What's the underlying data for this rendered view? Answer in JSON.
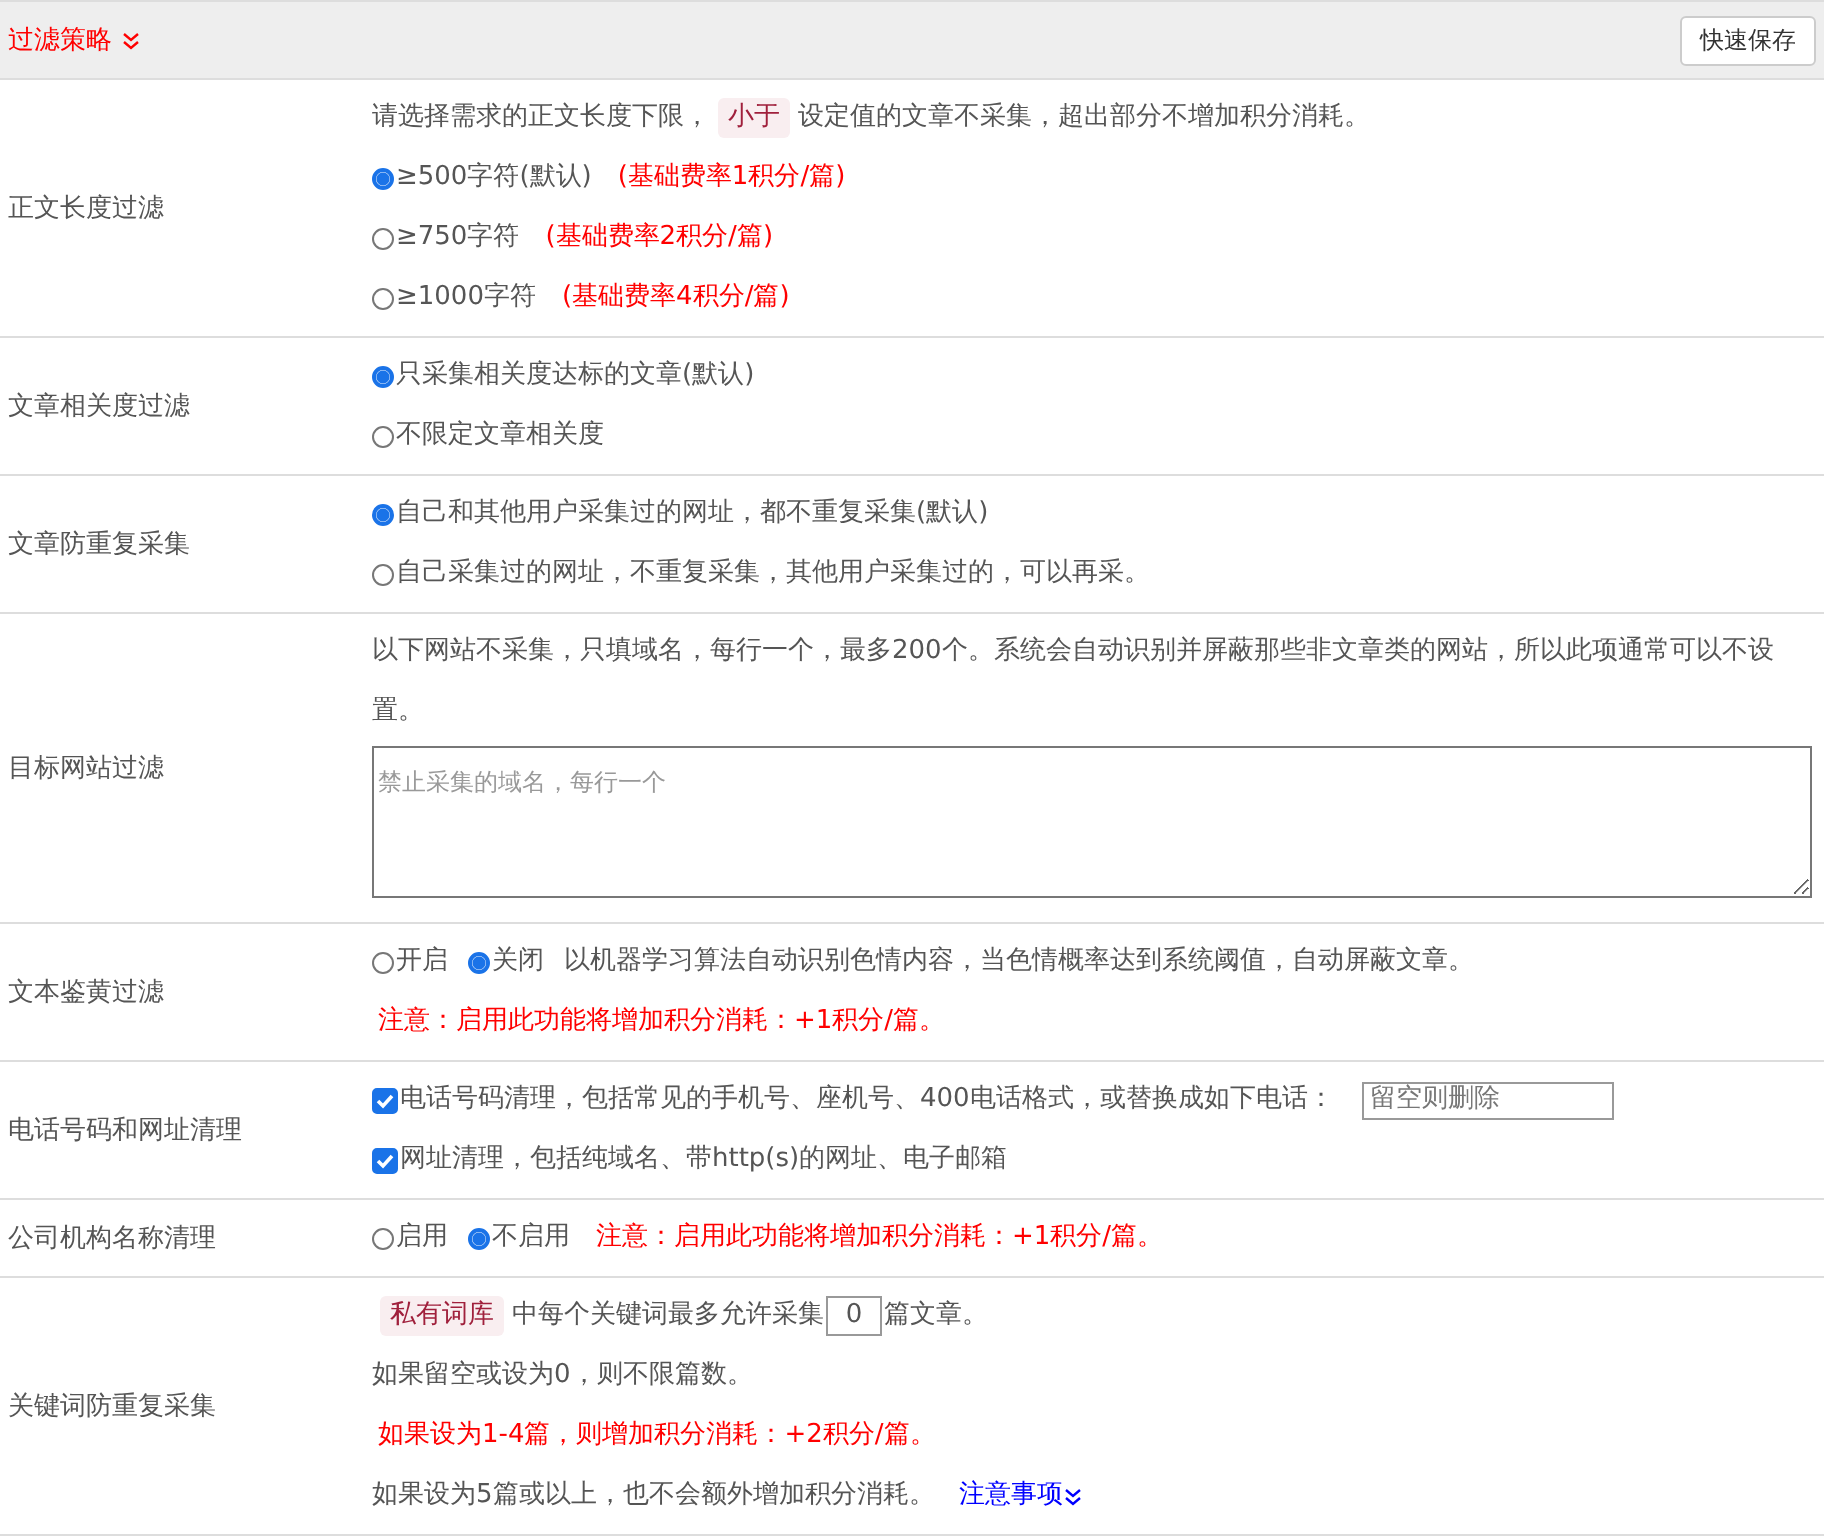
{
  "header": {
    "title": "过滤策略",
    "save_button": "快速保存"
  },
  "sections": [
    {
      "label": "正文长度过滤",
      "lines": [
        [
          {
            "kind": "text",
            "text": "请选择需求的正文长度下限，"
          },
          {
            "kind": "tag",
            "text": "小于"
          },
          {
            "kind": "text",
            "text": "设定值的文章不采集，超出部分不增加积分消耗。"
          }
        ],
        [
          {
            "kind": "radio",
            "label": "≥500字符(默认)",
            "selected": true
          },
          {
            "kind": "red",
            "text": "(基础费率1积分/篇)"
          }
        ],
        [
          {
            "kind": "radio",
            "label": "≥750字符",
            "selected": false
          },
          {
            "kind": "red",
            "text": "(基础费率2积分/篇)"
          }
        ],
        [
          {
            "kind": "radio",
            "label": "≥1000字符",
            "selected": false
          },
          {
            "kind": "red",
            "text": "(基础费率4积分/篇)"
          }
        ]
      ]
    },
    {
      "label": "文章相关度过滤",
      "lines": [
        [
          {
            "kind": "radio",
            "label": "只采集相关度达标的文章(默认)",
            "selected": true
          }
        ],
        [
          {
            "kind": "radio",
            "label": "不限定文章相关度",
            "selected": false
          }
        ]
      ]
    },
    {
      "label": "文章防重复采集",
      "lines": [
        [
          {
            "kind": "radio",
            "label": "自己和其他用户采集过的网址，都不重复采集(默认)",
            "selected": true
          }
        ],
        [
          {
            "kind": "radio",
            "label": "自己采集过的网址，不重复采集，其他用户采集过的，可以再采。",
            "selected": false
          }
        ]
      ]
    },
    {
      "label": "目标网站过滤",
      "lines": [
        [
          {
            "kind": "text",
            "text": "以下网站不采集，只填域名，每行一个，最多200个。系统会自动识别并屏蔽那些非文章类的网站，所以此项通常可以不设置。"
          }
        ],
        [
          {
            "kind": "textarea",
            "placeholder": "禁止采集的域名，每行一个"
          }
        ]
      ]
    },
    {
      "label": "文本鉴黄过滤",
      "lines": [
        [
          {
            "kind": "radio",
            "label": "开启",
            "selected": false
          },
          {
            "kind": "radio",
            "label": "关闭",
            "selected": true
          },
          {
            "kind": "text",
            "text": "以机器学习算法自动识别色情内容，当色情概率达到系统阈值，自动屏蔽文章。"
          }
        ],
        [
          {
            "kind": "red",
            "text": "注意：启用此功能将增加积分消耗：+1积分/篇。"
          }
        ]
      ]
    },
    {
      "label": "电话号码和网址清理",
      "lines": [
        [
          {
            "kind": "checkbox",
            "label": "电话号码清理，包括常见的手机号、座机号、400电话格式，或替换成如下电话：",
            "checked": true
          },
          {
            "kind": "field",
            "placeholder": "留空则删除"
          }
        ],
        [
          {
            "kind": "checkbox",
            "label": "网址清理，包括纯域名、带http(s)的网址、电子邮箱",
            "checked": true
          }
        ]
      ]
    },
    {
      "label": "公司机构名称清理",
      "lines": [
        [
          {
            "kind": "radio",
            "label": "启用",
            "selected": false
          },
          {
            "kind": "radio",
            "label": "不启用",
            "selected": true
          },
          {
            "kind": "red",
            "text": "注意：启用此功能将增加积分消耗：+1积分/篇。"
          }
        ]
      ]
    },
    {
      "label": "关键词防重复采集",
      "lines": [
        [
          {
            "kind": "tag",
            "text": "私有词库"
          },
          {
            "kind": "text",
            "text": "中每个关键词最多允许采集"
          },
          {
            "kind": "number",
            "value": "0"
          },
          {
            "kind": "text",
            "text": "篇文章。"
          }
        ],
        [
          {
            "kind": "text",
            "text": "如果留空或设为0，则不限篇数。"
          }
        ],
        [
          {
            "kind": "red",
            "text": "如果设为1-4篇，则增加积分消耗：+2积分/篇。"
          }
        ],
        [
          {
            "kind": "text",
            "text": "如果设为5篇或以上，也不会额外增加积分消耗。"
          },
          {
            "kind": "link",
            "text": "注意事项"
          }
        ]
      ]
    }
  ]
}
